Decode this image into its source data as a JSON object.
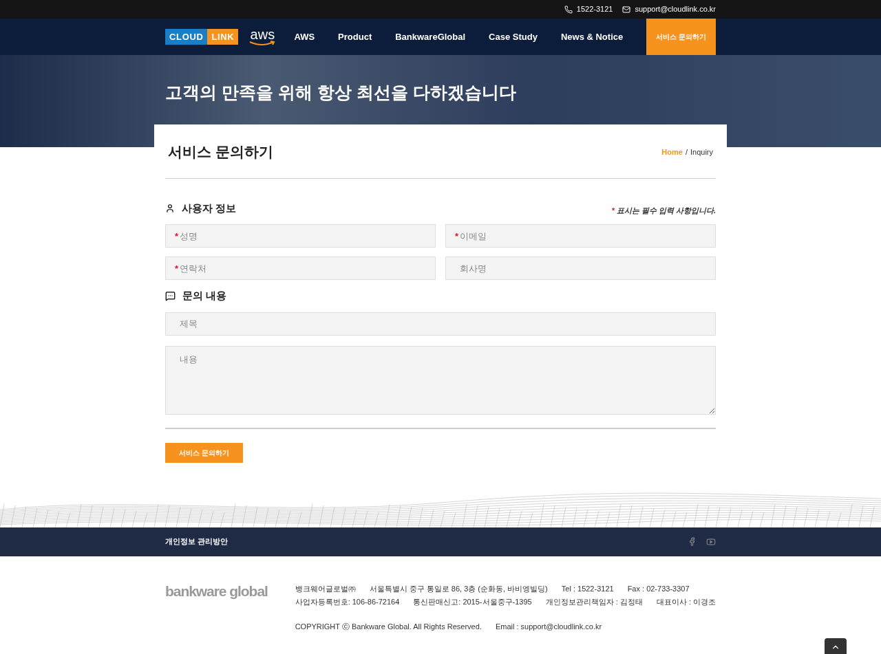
{
  "topbar": {
    "phone": "1522-3121",
    "email": "support@cloudlink.co.kr"
  },
  "nav": {
    "logo_left": "CLOUD",
    "logo_right": "LINK",
    "partner_logo": "aws",
    "items": [
      {
        "label": "AWS",
        "selected": false
      },
      {
        "label": "Product",
        "selected": false
      },
      {
        "label": "BankwareGlobal",
        "selected": false
      },
      {
        "label": "Case Study",
        "selected": false
      },
      {
        "label": "News & Notice",
        "selected": false
      },
      {
        "label": "서비스 문의하기",
        "selected": true
      }
    ]
  },
  "hero": {
    "title": "고객의 만족을 위해 항상 최선을 다하겠습니다"
  },
  "page": {
    "title": "서비스 문의하기",
    "breadcrumb": [
      {
        "label": "Home",
        "selected": false
      },
      {
        "label": "Inquiry",
        "selected": true
      }
    ],
    "separator": "/"
  },
  "form": {
    "required_mark": "*",
    "required_note": "표시는 필수 입력 사항입니다.",
    "sections": [
      {
        "title": "사용자 정보",
        "kind": "user",
        "fields": [
          {
            "placeholder": "성명",
            "required": true,
            "kind": "input"
          },
          {
            "placeholder": "이메일",
            "required": true,
            "kind": "input"
          },
          {
            "placeholder": "연락처",
            "required": true,
            "kind": "input"
          },
          {
            "placeholder": "회사명",
            "required": false,
            "kind": "input"
          }
        ]
      },
      {
        "title": "문의 내용",
        "kind": "chat",
        "fields": [
          {
            "placeholder": "제목",
            "required": false,
            "kind": "input"
          },
          {
            "placeholder": "내용",
            "required": false,
            "kind": "textarea"
          }
        ]
      }
    ],
    "submit": "서비스 문의하기"
  },
  "footer": {
    "privacy_link": "개인정보 관리방안",
    "logo": "bankware global",
    "info_rows": [
      [
        "뱅크웨어글로벌㈜",
        "서울특별시 중구 통일로 86, 3층 (순화동, 바비엥빌딩)",
        "Tel : 1522-3121",
        "Fax : 02-733-3307"
      ],
      [
        "사업자등록번호: 106-86-72164",
        "통신판매신고: 2015-서울중구-1395",
        "개인정보관리책임자 : 김정태",
        "대표이사 : 이경조"
      ]
    ],
    "copyright": "COPYRIGHT ⓒ Bankware Global. All Rights Reserved.",
    "email": "Email : support@cloudlink.co.kr"
  }
}
